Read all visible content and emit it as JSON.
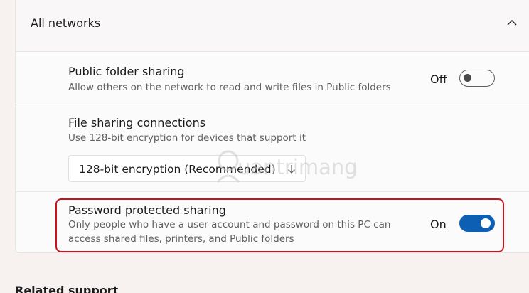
{
  "section": {
    "title": "All networks"
  },
  "public_folder_sharing": {
    "title": "Public folder sharing",
    "description": "Allow others on the network to read and write files in Public folders",
    "state": "Off"
  },
  "file_sharing_connections": {
    "title": "File sharing connections",
    "description": "Use 128-bit encryption for devices that support it",
    "selected": "128-bit encryption (Recommended)"
  },
  "password_protected_sharing": {
    "title": "Password protected sharing",
    "description_line1": "Only people who have a user account and password on this PC can",
    "description_line2": "access shared files, printers, and Public folders",
    "state": "On"
  },
  "watermark": {
    "text": "uantrimang"
  },
  "related_support": {
    "title": "Related support"
  },
  "icons": {
    "chevron": "chevron-up-icon",
    "select_arrow": "arrow-down-icon",
    "watermark_logo": "logo-icon"
  }
}
